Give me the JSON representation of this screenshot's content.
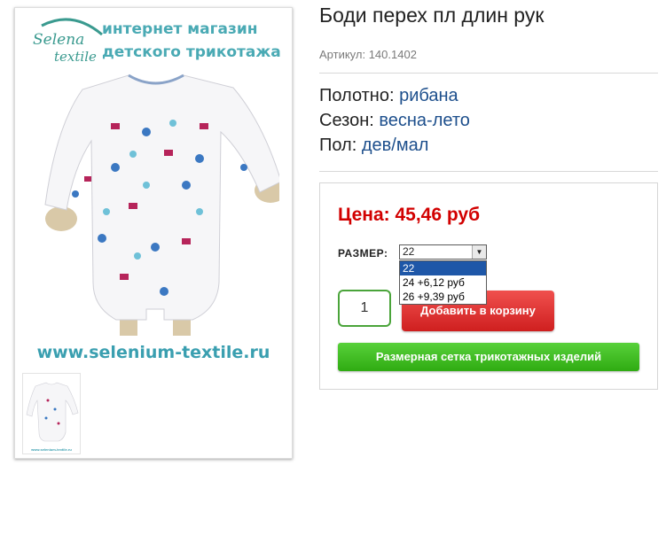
{
  "image": {
    "logo_line1": "Selena",
    "logo_line2": "textile",
    "shop_line1": "интернет магазин",
    "shop_line2": "детского трикотажа",
    "site_url": "www.selenium-textile.ru",
    "thumb_url": "www.selenium-textile.ru"
  },
  "product": {
    "title": "Боди перех пл длин рук",
    "sku_label": "Артикул:",
    "sku_value": "140.1402",
    "attributes": [
      {
        "label": "Полотно:",
        "value": "рибана"
      },
      {
        "label": "Сезон:",
        "value": "весна-лето"
      },
      {
        "label": "Пол:",
        "value": "дев/мал"
      }
    ]
  },
  "buy": {
    "price": "Цена: 45,46 руб",
    "size_label": "РАЗМЕР:",
    "size_selected": "22",
    "size_options": [
      "22",
      "24 +6,12 руб",
      "26 +9,39 руб"
    ],
    "quantity": "1",
    "add_to_cart": "Добавить в корзину",
    "size_chart": "Размерная сетка трикотажных изделий"
  },
  "colors": {
    "price": "#d20000",
    "accent_link": "#1d4f8c",
    "cart_button": "#e02f2f",
    "size_chart_button": "#3dbd1f",
    "qty_border": "#4aa43a"
  }
}
